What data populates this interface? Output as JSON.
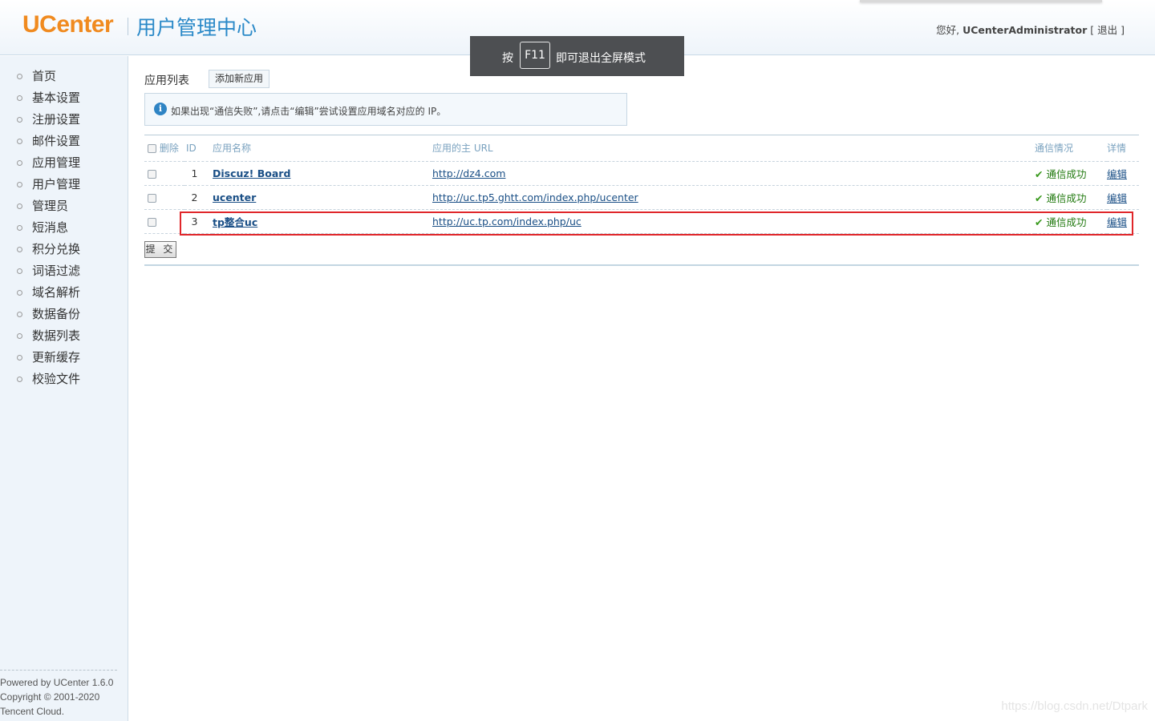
{
  "header": {
    "logo": "UCenter",
    "subtitle": "用户管理中心",
    "greeting": "您好,",
    "username": "UCenterAdministrator",
    "logout_open": "[",
    "logout_label": "退出",
    "logout_close": "]"
  },
  "overlay": {
    "pre": "按",
    "key": "F11",
    "post": "即可退出全屏模式"
  },
  "sidebar": {
    "items": [
      {
        "label": "首页"
      },
      {
        "label": "基本设置"
      },
      {
        "label": "注册设置"
      },
      {
        "label": "邮件设置"
      },
      {
        "label": "应用管理"
      },
      {
        "label": "用户管理"
      },
      {
        "label": "管理员"
      },
      {
        "label": "短消息"
      },
      {
        "label": "积分兑换"
      },
      {
        "label": "词语过滤"
      },
      {
        "label": "域名解析"
      },
      {
        "label": "数据备份"
      },
      {
        "label": "数据列表"
      },
      {
        "label": "更新缓存"
      },
      {
        "label": "校验文件"
      }
    ],
    "footer": {
      "line1": "Powered by UCenter 1.6.0",
      "line2": "Copyright © 2001-2020",
      "line3": "Tencent Cloud."
    }
  },
  "main": {
    "title": "应用列表",
    "add_button": "添加新应用",
    "notice": "如果出现“通信失败”,请点击“编辑”尝试设置应用域名对应的 IP。",
    "table": {
      "headers": {
        "delete": "删除",
        "id": "ID",
        "name": "应用名称",
        "url": "应用的主 URL",
        "status": "通信情况",
        "detail": "详情"
      },
      "rows": [
        {
          "id": "1",
          "name": "Discuz! Board",
          "url": "http://dz4.com",
          "status": "通信成功",
          "action": "编辑"
        },
        {
          "id": "2",
          "name": "ucenter",
          "url": "http://uc.tp5.ghtt.com/index.php/ucenter",
          "status": "通信成功",
          "action": "编辑"
        },
        {
          "id": "3",
          "name": "tp整合uc",
          "url": "http://uc.tp.com/index.php/uc",
          "status": "通信成功",
          "action": "编辑"
        }
      ]
    },
    "submit": "提 交"
  },
  "watermark": "https://blog.csdn.net/Dtpark",
  "colors": {
    "accent": "#2a89c8",
    "logo": "#f08a1f",
    "highlight": "#e0262a",
    "success": "#227a10"
  }
}
